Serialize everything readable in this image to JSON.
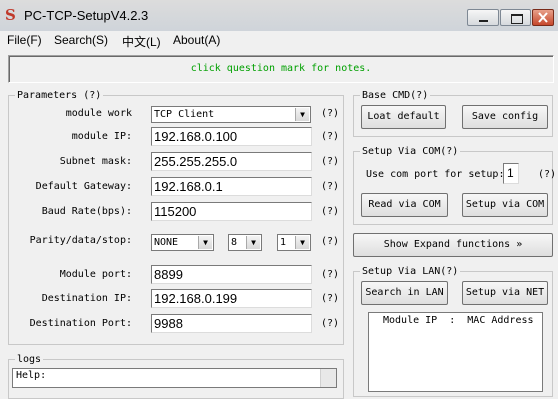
{
  "window": {
    "app_icon": "S",
    "title": "PC-TCP-SetupV4.2.3"
  },
  "menu": [
    "File(F)",
    "Search(S)",
    "中文(L)",
    "About(A)"
  ],
  "notice": "click question mark for notes.",
  "params": {
    "group_label": "Parameters (?)",
    "module_work_label": "module work",
    "module_work_value": "TCP Client",
    "module_ip_label": "module IP:",
    "module_ip_value": "192.168.0.100",
    "subnet_label": "Subnet mask:",
    "subnet_value": "255.255.255.0",
    "gateway_label": "Default Gateway:",
    "gateway_value": "192.168.0.1",
    "baud_label": "Baud Rate(bps):",
    "baud_value": "115200",
    "parity_label": "Parity/data/stop:",
    "parity_value": "NONE",
    "data_value": "8",
    "stop_value": "1",
    "module_port_label": "Module port:",
    "module_port_value": "8899",
    "dest_ip_label": "Destination IP:",
    "dest_ip_value": "192.168.0.199",
    "dest_port_label": "Destination Port:",
    "dest_port_value": "9988",
    "q": "(?)"
  },
  "logs": {
    "group_label": "logs",
    "help": "Help:"
  },
  "base_cmd": {
    "group_label": "Base CMD(?)",
    "load_default": "Loat default",
    "save_config": "Save config"
  },
  "setup_com": {
    "group_label": "Setup Via COM(?)",
    "com_label": "Use com port for setup:",
    "com_value": "1",
    "q": "(?)",
    "read_via_com": "Read via COM",
    "setup_via_com": "Setup via COM"
  },
  "expand": {
    "label": "Show Expand functions  »"
  },
  "setup_lan": {
    "group_label": "Setup Via LAN(?)",
    "search_in_lan": "Search in LAN",
    "setup_via_net": "Setup via NET",
    "list_header": "Module IP  :  MAC Address"
  }
}
